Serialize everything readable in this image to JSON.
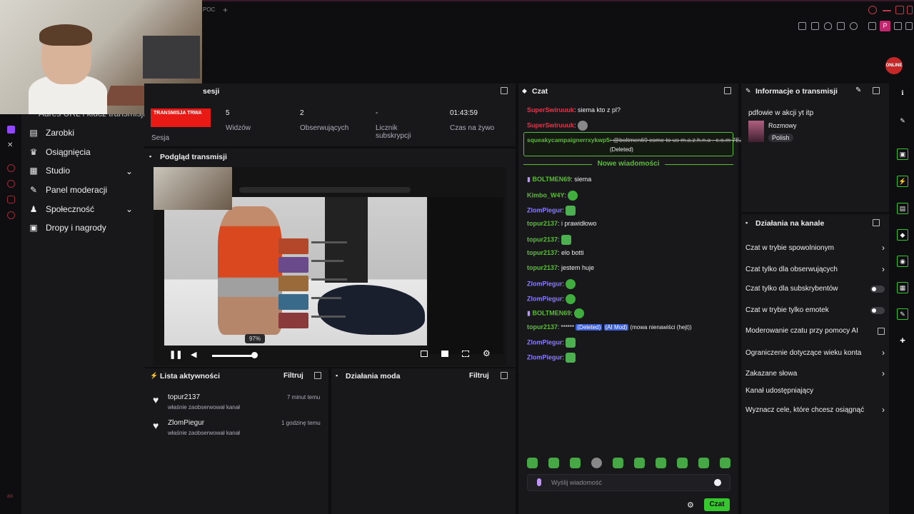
{
  "browser": {
    "tab_label": "POC",
    "new_tab": "+",
    "profile_letter": "P",
    "brand_badge": "ONLINE"
  },
  "sidebar": {
    "cut_item": "Adres URL i klucz transmisji",
    "items": [
      {
        "label": "Zarobki",
        "icon": "dollar-icon"
      },
      {
        "label": "Osiągnięcia",
        "icon": "trophy-icon"
      },
      {
        "label": "Studio",
        "icon": "studio-icon"
      },
      {
        "label": "Panel moderacji",
        "icon": "wrench-icon"
      },
      {
        "label": "Społeczność",
        "icon": "community-icon"
      },
      {
        "label": "Dropy i nagrody",
        "icon": "gift-icon"
      }
    ]
  },
  "stats": {
    "title_fragment": "sesji",
    "live_tag": "TRANSMISJA TRWA",
    "session_label": "Sesja",
    "items": [
      {
        "value": "5",
        "label": "Widzów"
      },
      {
        "value": "2",
        "label": "Obserwujących"
      },
      {
        "value": "-",
        "label": "Licznik subskrypcji"
      },
      {
        "value": "01:43:59",
        "label": "Czas na żywo"
      }
    ]
  },
  "preview": {
    "title": "Podgląd transmisji",
    "volume_tooltip": "97%",
    "volume_percent": 97
  },
  "activity": {
    "title": "Lista aktywności",
    "filter": "Filtruj",
    "events": [
      {
        "user": "topur2137",
        "action": "właśnie zaobserwował kanał",
        "time": "7 minut temu"
      },
      {
        "user": "ZlomPiegur",
        "action": "właśnie zaobserwował kanał",
        "time": "1 godzinę temu"
      }
    ]
  },
  "mod_actions": {
    "title": "Działania moda",
    "filter": "Filtruj"
  },
  "chat": {
    "title": "Czat",
    "messages_top": [
      {
        "user": "SuperSwiruuuk",
        "color": "#e6344a",
        "text": ": siema kto z pl?",
        "emote": false
      },
      {
        "user": "SuperSwiruuuk",
        "color": "#e6344a",
        "text": ":",
        "emote": true
      }
    ],
    "highlight": {
      "user": "squeakycampaignerrxykwp5",
      "text": ": @boltmen69 come to us m.a.z.h.n.a . c.o.m 7EJXV73",
      "deleted": "(Deleted)"
    },
    "new_messages": "Nowe wiadomości",
    "messages": [
      {
        "user": "BOLTMEN69",
        "color": "#5dbb3b",
        "text": ": siema",
        "emote": false,
        "badge": true
      },
      {
        "user": "Kimbo_W4Y",
        "color": "#5dbb3b",
        "text": ":",
        "emote": true,
        "badge": false
      },
      {
        "user": "ZlomPiegur",
        "color": "#8a7dff",
        "text": ":",
        "emote": true,
        "badge": false
      },
      {
        "user": "topur2137",
        "color": "#5dbb3b",
        "text": ": i prawidłowo",
        "emote": false,
        "badge": false
      },
      {
        "user": "topur2137",
        "color": "#5dbb3b",
        "text": ":",
        "emote": true,
        "badge": false
      },
      {
        "user": "topur2137",
        "color": "#5dbb3b",
        "text": ": elo botti",
        "emote": false,
        "badge": false
      },
      {
        "user": "topur2137",
        "color": "#5dbb3b",
        "text": ": jestem huje",
        "emote": false,
        "badge": false
      },
      {
        "user": "ZlomPiegur",
        "color": "#8a7dff",
        "text": ":",
        "emote": true,
        "badge": false
      },
      {
        "user": "ZlomPiegur",
        "color": "#8a7dff",
        "text": ":",
        "emote": true,
        "badge": false
      },
      {
        "user": "BOLTMEN69",
        "color": "#5dbb3b",
        "text": ":",
        "emote": true,
        "badge": true
      },
      {
        "user": "topur2137",
        "color": "#5dbb3b",
        "text": ": ******",
        "emote": false,
        "badge": false,
        "tags": [
          "(Deleted)",
          "(AI Mod)"
        ],
        "tail": "(mowa nienawiści (hejt))"
      },
      {
        "user": "ZlomPiegur",
        "color": "#8a7dff",
        "text": ":",
        "emote": true,
        "badge": false
      },
      {
        "user": "ZlomPiegur",
        "color": "#8a7dff",
        "text": ":",
        "emote": true,
        "badge": false
      }
    ],
    "input_placeholder": "Wyślij wiadomość",
    "send_label": "Czat"
  },
  "stream_info": {
    "title": "Informacje o transmisji",
    "stream_title": "pdfowie w akcji yt itp",
    "category": "Rozmowy",
    "language": "Polish"
  },
  "channel_actions": {
    "title": "Działania na kanale",
    "items": [
      {
        "label": "Czat w trybie spowolnionym",
        "control": "chevron"
      },
      {
        "label": "Czat tylko dla obserwujących",
        "control": "chevron"
      },
      {
        "label": "Czat tylko dla subskrybentów",
        "control": "toggle"
      },
      {
        "label": "Czat w trybie tylko emotek",
        "control": "toggle"
      },
      {
        "label": "Moderowanie czatu przy pomocy AI",
        "control": "external"
      },
      {
        "label": "Ograniczenie dotyczące wieku konta",
        "control": "chevron"
      },
      {
        "label": "Zakazane słowa",
        "control": "chevron"
      },
      {
        "label": "Kanał udostępniający",
        "control": "none"
      },
      {
        "label": "Wyznacz cele, które chcesz osiągnąć",
        "control": "chevron"
      }
    ]
  },
  "colors": {
    "accent_green": "#36c72e",
    "live_red": "#e91916",
    "panel_bg": "#18181b",
    "page_bg": "#0e0e10"
  }
}
